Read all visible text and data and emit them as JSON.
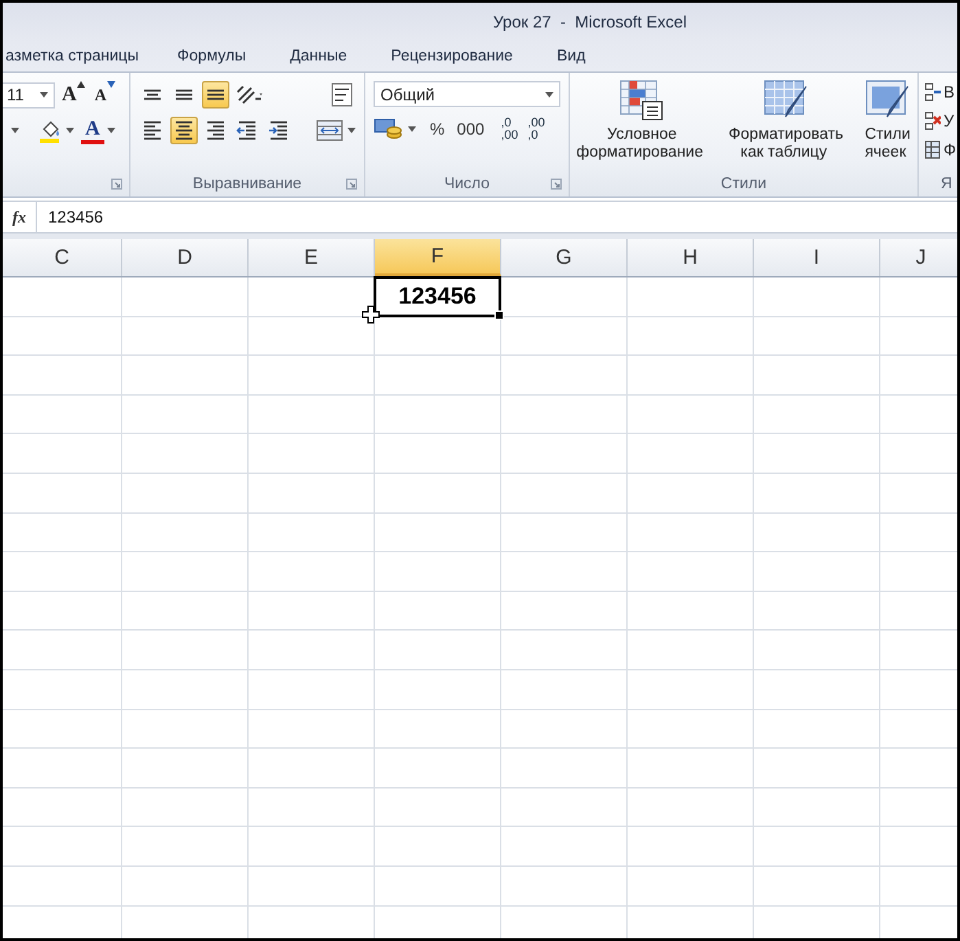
{
  "window": {
    "title": "Урок 27  -  Microsoft Excel"
  },
  "ribbon_tabs": [
    {
      "label": "азметка страницы",
      "selected": false
    },
    {
      "label": "Формулы",
      "selected": false
    },
    {
      "label": "Данные",
      "selected": false
    },
    {
      "label": "Рецензирование",
      "selected": false
    },
    {
      "label": "Вид",
      "selected": false
    }
  ],
  "font_group": {
    "font_size": "11",
    "grow_label": "A",
    "shrink_label": "A",
    "font_color_label": "A"
  },
  "alignment_group": {
    "label": "Выравнивание",
    "top_row": [
      {
        "kind": "top",
        "selected": false
      },
      {
        "kind": "middle",
        "selected": false
      },
      {
        "kind": "bottom",
        "selected": true
      },
      {
        "kind": "orientation",
        "selected": false
      }
    ],
    "bottom_row": [
      {
        "kind": "left",
        "selected": false
      },
      {
        "kind": "center",
        "selected": true
      },
      {
        "kind": "right",
        "selected": false
      },
      {
        "kind": "outdent",
        "selected": false
      },
      {
        "kind": "indent",
        "selected": false
      }
    ]
  },
  "number_group": {
    "label": "Число",
    "format": "Общий",
    "percent": "%",
    "thousands": "000",
    "increase_decimal": [
      ",0",
      ",00"
    ],
    "decrease_decimal": [
      ",00",
      ",0"
    ]
  },
  "styles_group": {
    "label": "Стили",
    "buttons": [
      {
        "kind": "conditional",
        "lines": [
          "Условное",
          "форматирование"
        ]
      },
      {
        "kind": "table",
        "lines": [
          "Форматировать",
          "как таблицу"
        ]
      },
      {
        "kind": "cell_styles",
        "lines": [
          "Стили",
          "ячеек"
        ]
      }
    ]
  },
  "cells_group": {
    "label": "Я",
    "items": [
      "В",
      "У",
      "Ф"
    ]
  },
  "formula_bar": {
    "fx": "fx",
    "value": "123456"
  },
  "sheet": {
    "columns": [
      {
        "label": "C",
        "selected": false
      },
      {
        "label": "D",
        "selected": false
      },
      {
        "label": "E",
        "selected": false
      },
      {
        "label": "F",
        "selected": true
      },
      {
        "label": "G",
        "selected": false
      },
      {
        "label": "H",
        "selected": false
      },
      {
        "label": "I",
        "selected": false
      },
      {
        "label": "J",
        "selected": false
      }
    ],
    "active_cell": {
      "value": "123456"
    }
  }
}
